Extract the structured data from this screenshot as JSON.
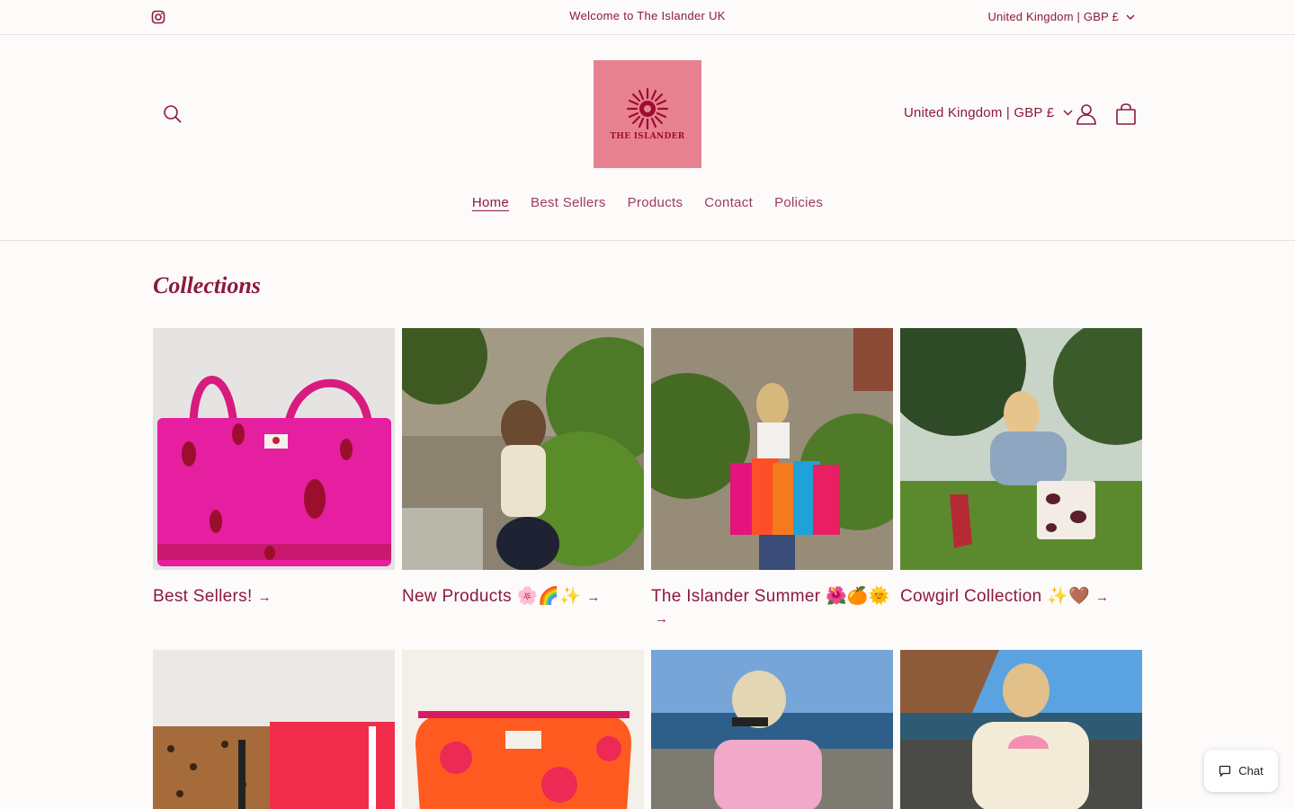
{
  "announcement": {
    "message": "Welcome to The Islander UK",
    "country_selector": "United Kingdom | GBP £"
  },
  "header": {
    "logo_text": "THE ISLANDER",
    "country_selector": "United Kingdom | GBP £",
    "nav": [
      {
        "label": "Home",
        "active": true
      },
      {
        "label": "Best Sellers",
        "active": false
      },
      {
        "label": "Products",
        "active": false
      },
      {
        "label": "Contact",
        "active": false
      },
      {
        "label": "Policies",
        "active": false
      }
    ]
  },
  "main": {
    "title": "Collections",
    "collections": [
      {
        "label": "Best Sellers!",
        "arrow": "→"
      },
      {
        "label": "New Products 🌸🌈✨",
        "arrow": "→"
      },
      {
        "label": "The Islander Summer 🌺🍊🌞",
        "arrow": "→"
      },
      {
        "label": "Cowgirl Collection ✨🤎",
        "arrow": "→"
      }
    ]
  },
  "chat": {
    "label": "Chat"
  },
  "colors": {
    "brand": "#8b1a3d",
    "logo_bg": "#e88291",
    "background": "#fdfafa"
  },
  "icons": [
    "instagram-icon",
    "search-icon",
    "chevron-down-icon",
    "account-icon",
    "cart-icon",
    "chat-icon",
    "arrow-right-icon"
  ]
}
